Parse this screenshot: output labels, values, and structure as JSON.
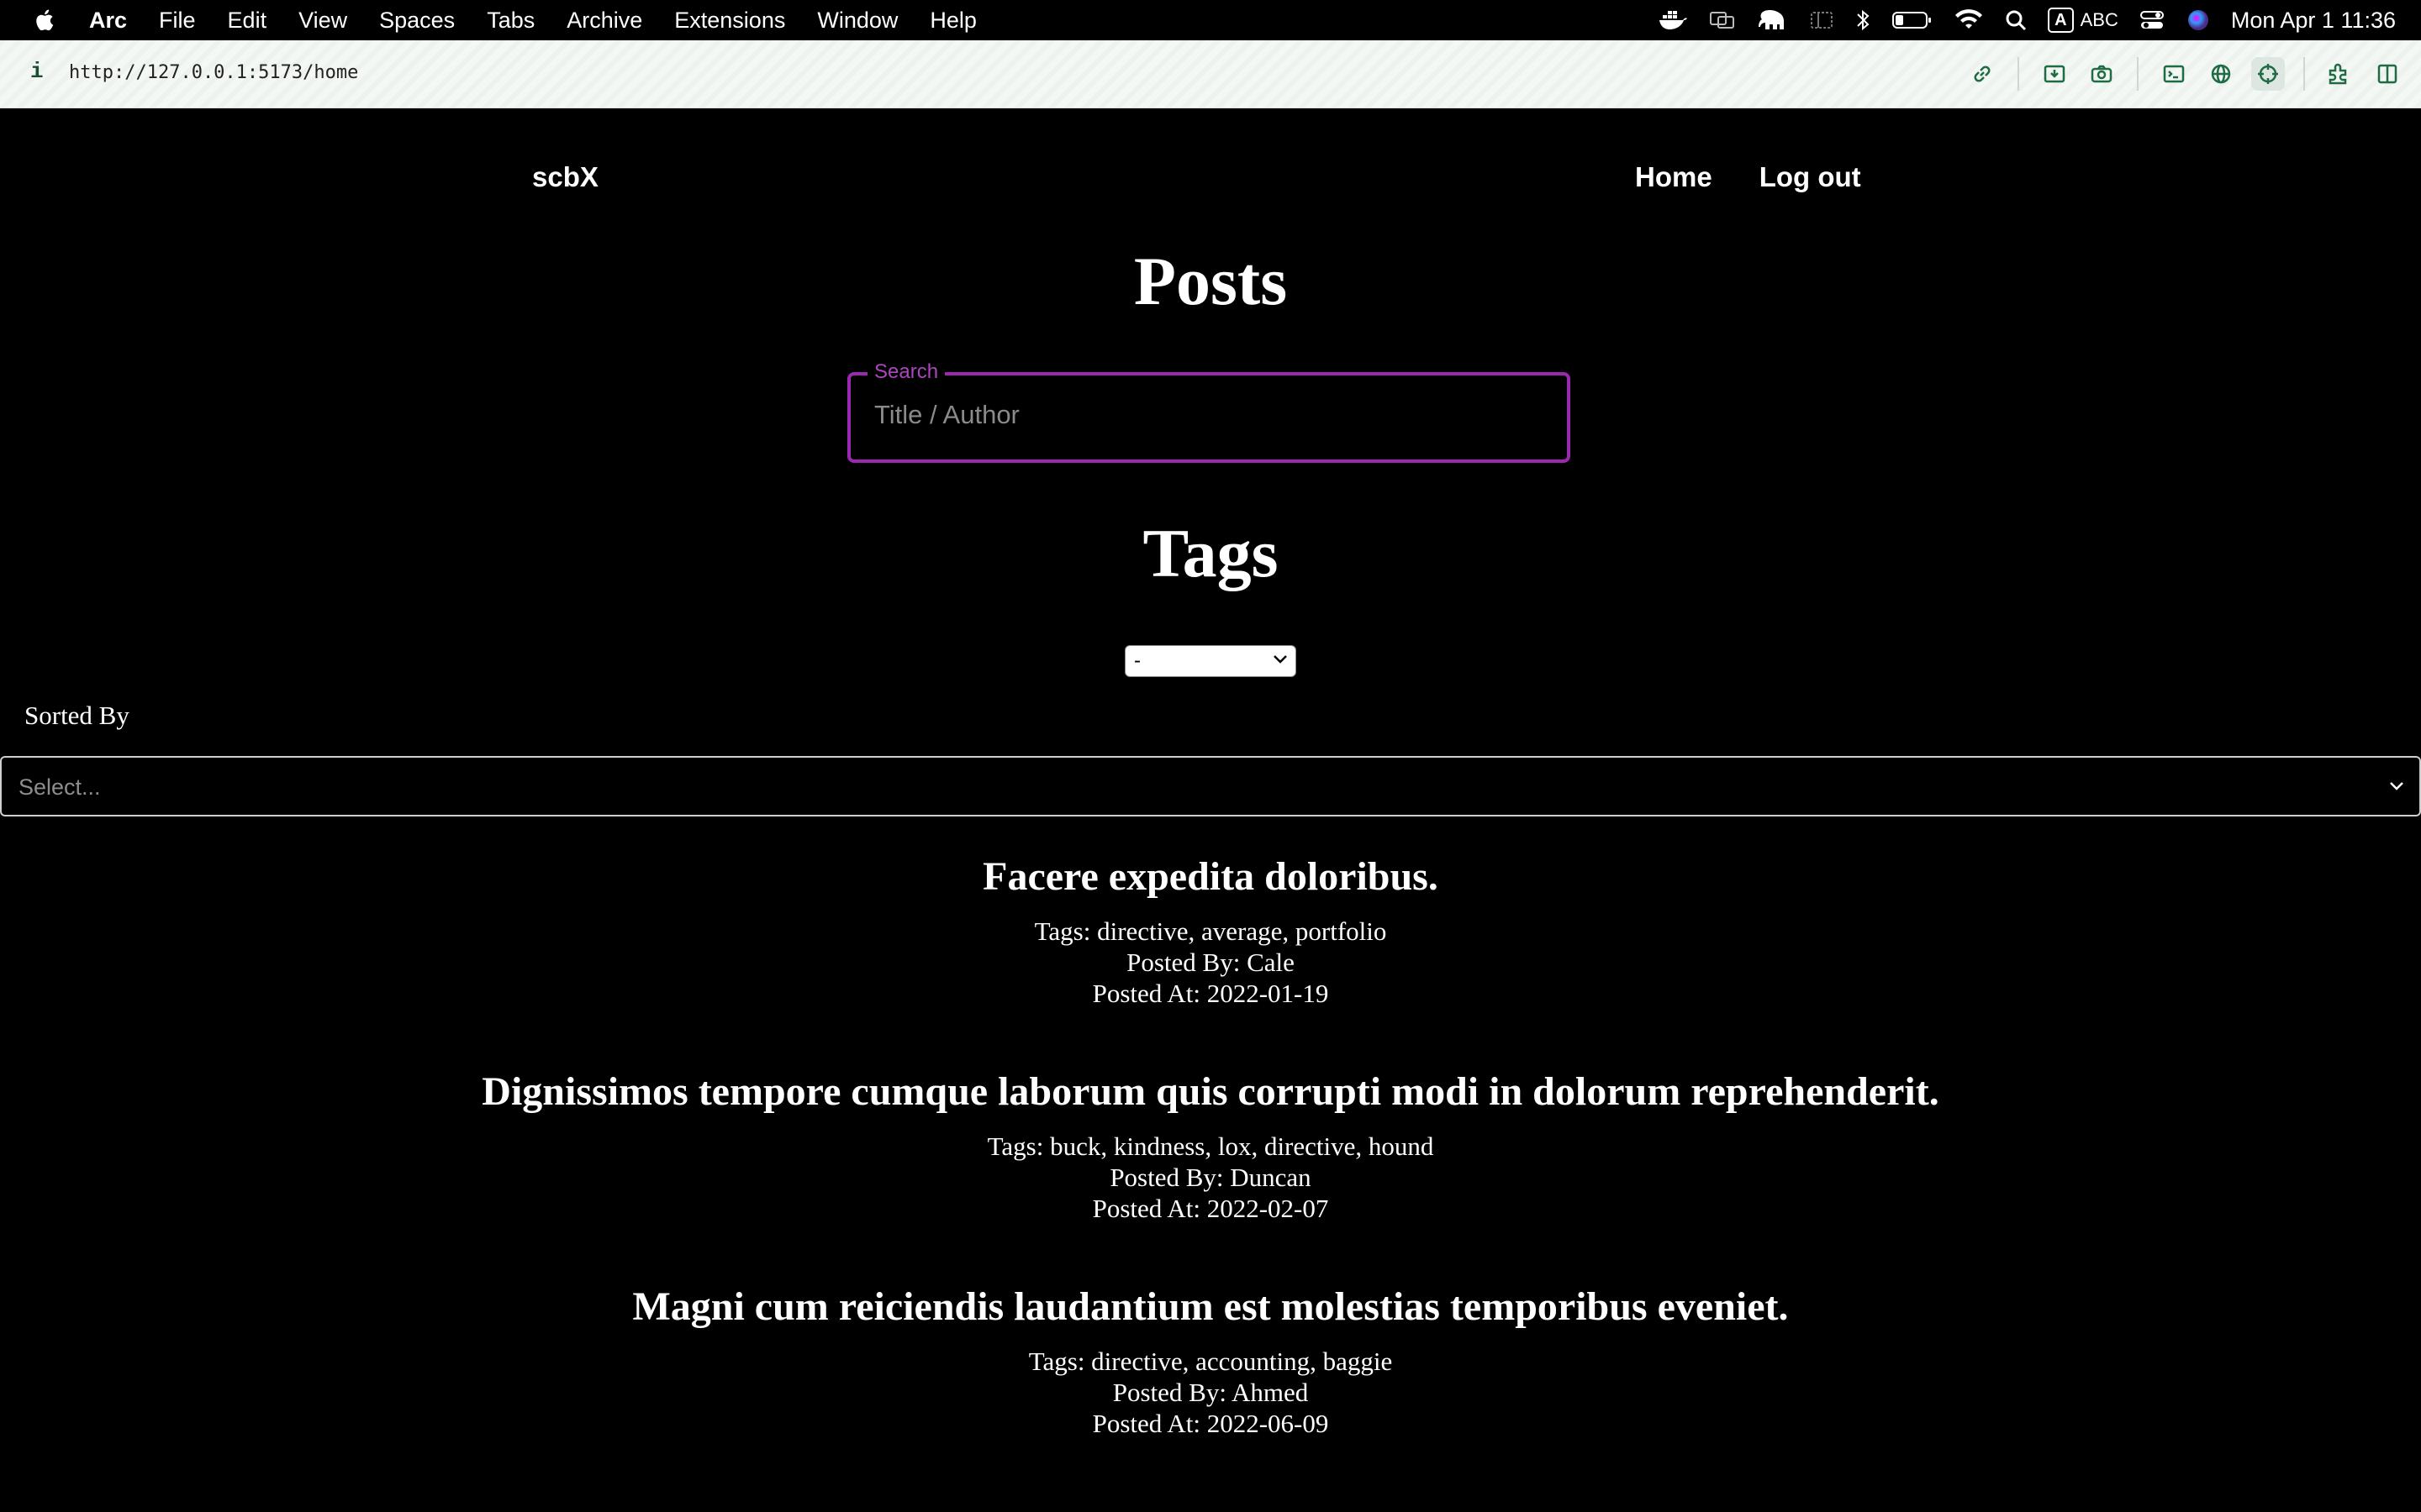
{
  "menubar": {
    "app": "Arc",
    "items": [
      "File",
      "Edit",
      "View",
      "Spaces",
      "Tabs",
      "Archive",
      "Extensions",
      "Window",
      "Help"
    ],
    "input_source": "ABC",
    "input_badge": "A",
    "datetime": "Mon Apr 1  11:36"
  },
  "browser": {
    "info_icon_label": "i",
    "url": "http://127.0.0.1:5173/home"
  },
  "nav": {
    "brand": "scbX",
    "links": [
      "Home",
      "Log out"
    ]
  },
  "page": {
    "posts_heading": "Posts",
    "search_label": "Search",
    "search_placeholder": "Title / Author",
    "search_value": "",
    "tags_heading": "Tags",
    "tags_selected": "-",
    "sorted_by_label": "Sorted By",
    "sort_placeholder": "Select..."
  },
  "posts": [
    {
      "title": "Facere expedita doloribus.",
      "tags_line": "Tags: directive, average, portfolio",
      "author_line": "Posted By: Cale",
      "date_line": "Posted At: 2022-01-19"
    },
    {
      "title": "Dignissimos tempore cumque laborum quis corrupti modi in dolorum reprehenderit.",
      "tags_line": "Tags: buck, kindness, lox, directive, hound",
      "author_line": "Posted By: Duncan",
      "date_line": "Posted At: 2022-02-07"
    },
    {
      "title": "Magni cum reiciendis laudantium est molestias temporibus eveniet.",
      "tags_line": "Tags: directive, accounting, baggie",
      "author_line": "Posted By: Ahmed",
      "date_line": "Posted At: 2022-06-09"
    }
  ],
  "colors": {
    "page_bg": "#000000",
    "accent": "#9c27b0",
    "text": "#ffffff",
    "urlbar_bg": "#f4f8f5",
    "urlbar_icon": "#1e6b44"
  },
  "icons": {
    "menubar_status": [
      "docker-icon",
      "display-icon",
      "tableplus-elephant-icon",
      "sidebar-icon",
      "bluetooth-icon",
      "battery-icon",
      "wifi-icon",
      "search-icon",
      "control-center-icon",
      "siri-icon"
    ],
    "browser_tools": [
      "copy-link-icon",
      "capture-icon",
      "camera-icon",
      "terminal-icon",
      "globe-icon",
      "crosshair-icon",
      "extensions-icon",
      "split-view-icon"
    ]
  }
}
